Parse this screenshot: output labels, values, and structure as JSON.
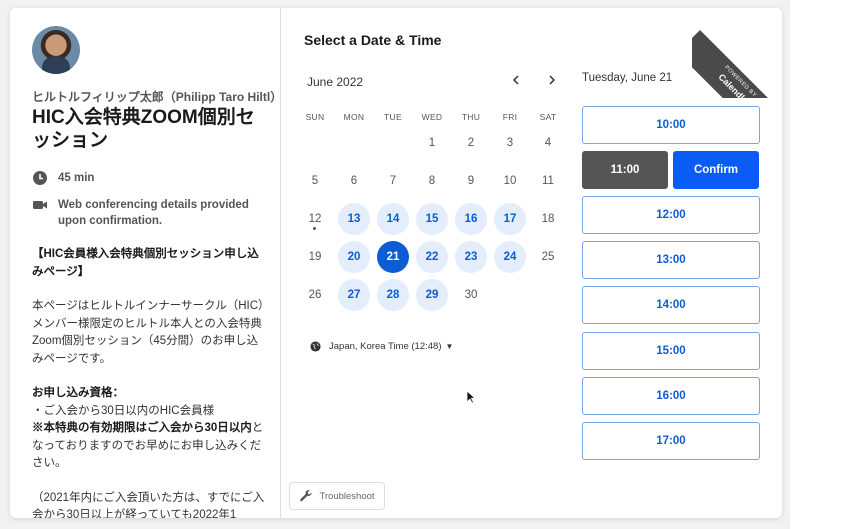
{
  "event": {
    "host": "ヒルトルフィリップ太郎（Philipp Taro Hiltl）",
    "title": "HIC入会特典ZOOM個別セッション",
    "duration": "45 min",
    "conferencing": "Web conferencing details provided upon confirmation.",
    "description": {
      "heading": "【HIC会員様入会特典個別セッション申し込みページ】",
      "intro": "本ページはヒルトルインナーサークル（HIC）メンバー様限定のヒルトル本人との入会特典Zoom個別セッション（45分間）のお申し込みページです。",
      "eligibility_title": "お申し込み資格：",
      "eligibility_item": "・ご入会から30日以内のHIC会員様",
      "notice_bold": "※本特典の有効期限はご入会から30日以内",
      "notice_rest": "となっておりますのでお早めにお申し込みください。",
      "note": "（2021年内にご入会頂いた方は、すでにご入会から30日以上が経っていても2022年1"
    }
  },
  "calendar": {
    "heading": "Select a Date & Time",
    "month_label": "June 2022",
    "prev_icon": "chevron-left-icon",
    "next_icon": "chevron-right-icon",
    "weekdays": [
      "SUN",
      "MON",
      "TUE",
      "WED",
      "THU",
      "FRI",
      "SAT"
    ],
    "weeks": [
      [
        null,
        null,
        null,
        {
          "d": "1"
        },
        {
          "d": "2"
        },
        {
          "d": "3"
        },
        {
          "d": "4"
        }
      ],
      [
        {
          "d": "5"
        },
        {
          "d": "6"
        },
        {
          "d": "7"
        },
        {
          "d": "8"
        },
        {
          "d": "9"
        },
        {
          "d": "10"
        },
        {
          "d": "11"
        }
      ],
      [
        {
          "d": "12",
          "today": true
        },
        {
          "d": "13",
          "avail": true
        },
        {
          "d": "14",
          "avail": true
        },
        {
          "d": "15",
          "avail": true
        },
        {
          "d": "16",
          "avail": true
        },
        {
          "d": "17",
          "avail": true
        },
        {
          "d": "18"
        }
      ],
      [
        {
          "d": "19"
        },
        {
          "d": "20",
          "avail": true
        },
        {
          "d": "21",
          "avail": true,
          "selected": true
        },
        {
          "d": "22",
          "avail": true
        },
        {
          "d": "23",
          "avail": true
        },
        {
          "d": "24",
          "avail": true
        },
        {
          "d": "25"
        }
      ],
      [
        {
          "d": "26"
        },
        {
          "d": "27",
          "avail": true
        },
        {
          "d": "28",
          "avail": true
        },
        {
          "d": "29",
          "avail": true
        },
        {
          "d": "30"
        },
        null,
        null
      ]
    ],
    "timezone": "Japan, Korea Time (12:48)"
  },
  "times": {
    "selected_date": "Tuesday, June 21",
    "slots_before": [
      "10:00"
    ],
    "selected_slot": "11:00",
    "confirm_label": "Confirm",
    "slots_after": [
      "12:00",
      "13:00",
      "14:00",
      "15:00",
      "16:00",
      "17:00"
    ]
  },
  "troubleshoot_label": "Troubleshoot",
  "badge": {
    "powered": "POWERED BY",
    "brand": "Calendly"
  },
  "colors": {
    "accent": "#0b5cd5",
    "available_bg": "#e3edfc",
    "selected_slot_bg": "#555555"
  }
}
